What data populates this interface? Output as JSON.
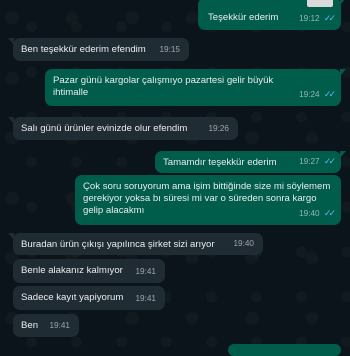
{
  "messages": [
    {
      "dir": "out",
      "text": "Teşekkür ederim",
      "time": "19:12",
      "ticks": "read"
    },
    {
      "dir": "in",
      "text": "Ben teşekkür ederim efendim",
      "time": "19:15"
    },
    {
      "dir": "out",
      "text": "Pazar günü kargolar çalışmıyo pazartesi gelir büyük ihtimalle",
      "time": "19:24",
      "ticks": "read"
    },
    {
      "dir": "in",
      "text": "Salı günü ürünler evinizde olur efendim",
      "time": "19:26"
    },
    {
      "dir": "out",
      "text": "Tamamdır teşekkür ederim",
      "time": "19:27",
      "ticks": "read"
    },
    {
      "dir": "out",
      "text": "Çok soru soruyorum ama işim bittiğinde size mi söylemem gerekiyor yoksa bı süresi mi var o süreden sonra kargo gelip alacakmı",
      "time": "19:40",
      "ticks": "read"
    },
    {
      "dir": "in",
      "text": "Buradan ürün çıkışı yapılınca şirket sizi arıyor",
      "time": "19:40"
    },
    {
      "dir": "in",
      "text": "Benle alakanız kalmıyor",
      "time": "19:41"
    },
    {
      "dir": "in",
      "text": "Sadece kayıt yapiyorum",
      "time": "19:41"
    },
    {
      "dir": "in",
      "text": "Ben",
      "time": "19:41"
    }
  ],
  "colors": {
    "background": "#0b141a",
    "incoming_bubble": "#202c33",
    "outgoing_bubble": "#005c4b",
    "read_ticks": "#53bdeb"
  },
  "icons": {
    "read_ticks": "double-check-icon"
  }
}
